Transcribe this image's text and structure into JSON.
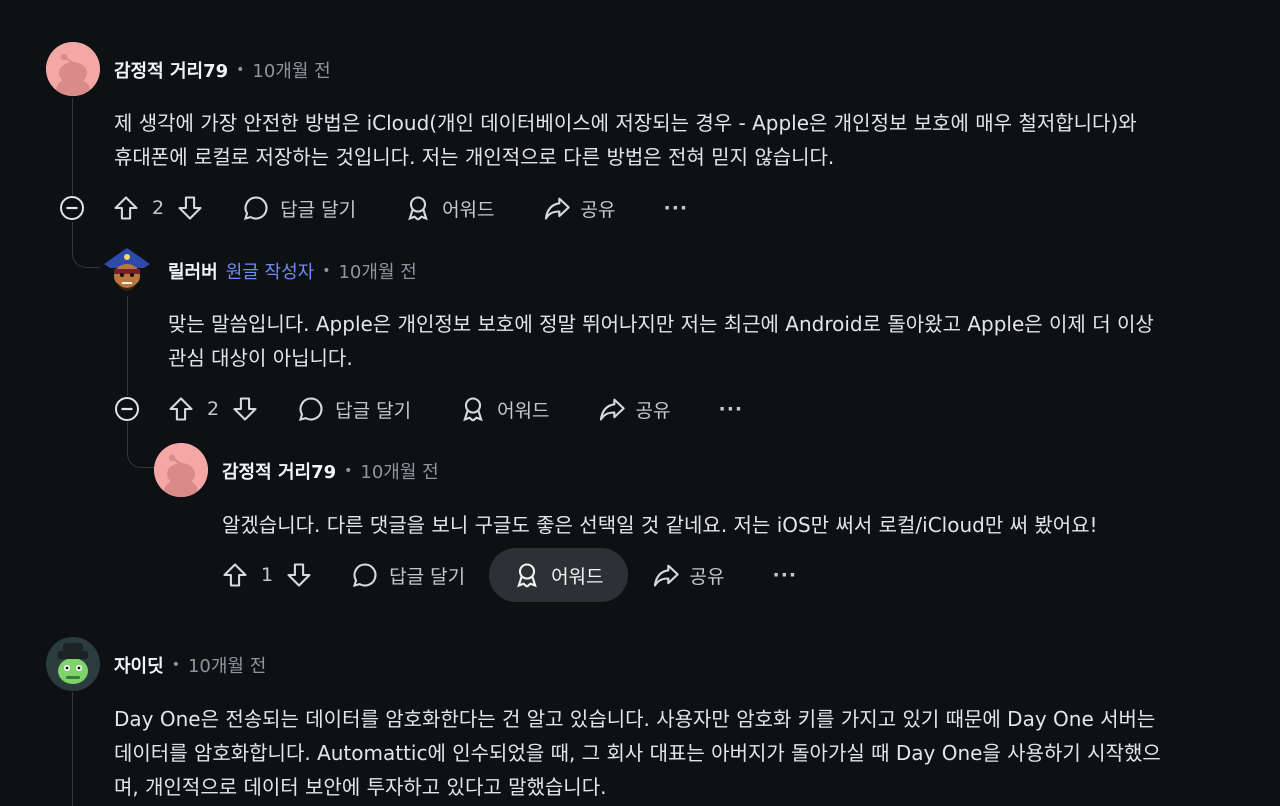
{
  "comments": [
    {
      "author": "감정적 거리79",
      "time": "10개월 전",
      "lines": [
        "제 생각에 가장 안전한 방법은 iCloud(개인 데이터베이스에 저장되는 경우 - Apple은 개인정보 보호에 매우 철저합니다)와",
        "휴대폰에 로컬로 저장하는 것입니다. 저는 개인적으로 다른 방법은 전혀 믿지 않습니다."
      ],
      "votes": "2"
    },
    {
      "author": "릴러버",
      "op_label": "원글 작성자",
      "time": "10개월 전",
      "lines": [
        "맞는 말씀입니다. Apple은 개인정보 보호에 정말 뛰어나지만 저는 최근에 Android로 돌아왔고 Apple은 이제 더 이상",
        "관심 대상이 아닙니다."
      ],
      "votes": "2"
    },
    {
      "author": "감정적 거리79",
      "time": "10개월 전",
      "lines": [
        "알겠습니다. 다른 댓글을 보니 구글도 좋은 선택일 것 같네요. 저는 iOS만 써서 로컬/iCloud만 써 봤어요!"
      ],
      "votes": "1"
    },
    {
      "author": "자이딧",
      "time": "10개월 전",
      "lines": [
        "Day One은 전송되는 데이터를 암호화한다는 건 알고 있습니다. 사용자만 암호화 키를 가지고 있기 때문에 Day One 서버는",
        "데이터를 암호화합니다. Automattic에 인수되었을 때, 그 회사 대표는 아버지가 돌아가실 때 Day One을 사용하기 시작했으",
        "며, 개인적으로 데이터 보안에 투자하고 있다고 말했습니다."
      ]
    }
  ],
  "actions": {
    "reply": "답글 달기",
    "award": "어워드",
    "share": "공유",
    "more": "···"
  },
  "icons": {
    "upvote": "upvote-icon",
    "downvote": "downvote-icon",
    "reply": "comment-icon",
    "award": "award-icon",
    "share": "share-icon",
    "collapse": "collapse-icon"
  },
  "colors": {
    "background": "#0e1113",
    "op_label": "#6e8cf7",
    "hover_pill": "#2b3236"
  }
}
